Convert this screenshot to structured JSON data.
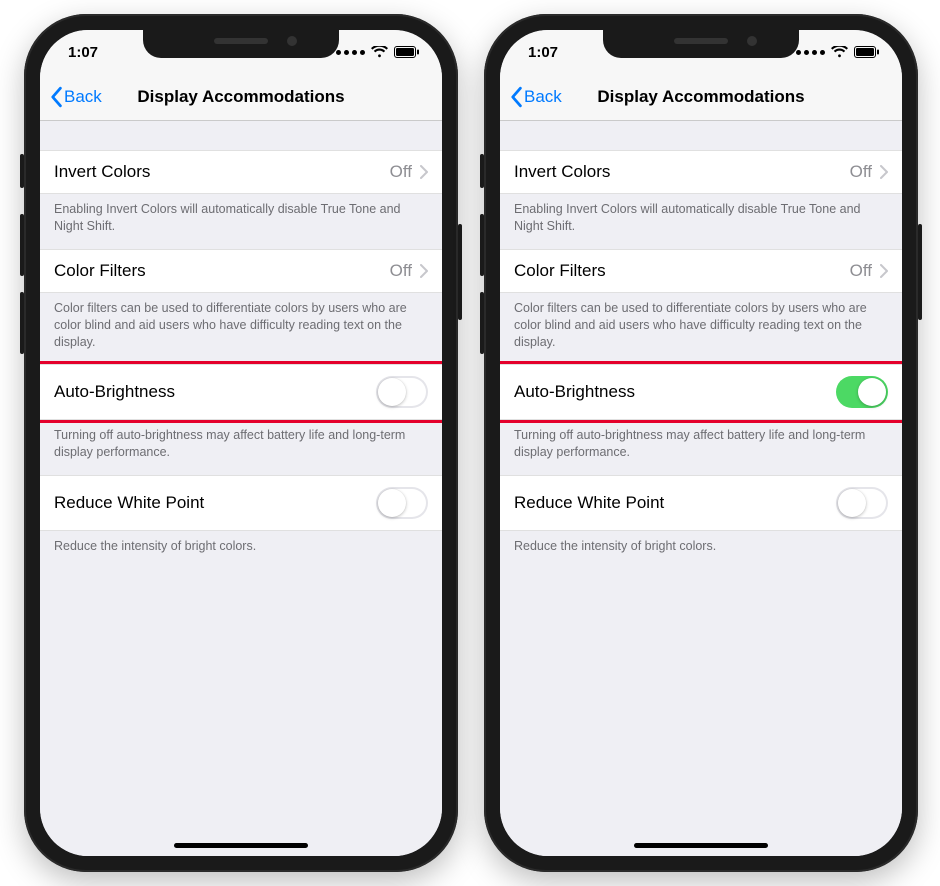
{
  "statusbar": {
    "time": "1:07"
  },
  "navbar": {
    "back": "Back",
    "title": "Display Accommodations"
  },
  "sections": {
    "invert": {
      "label": "Invert Colors",
      "value": "Off",
      "footer": "Enabling Invert Colors will automatically disable True Tone and Night Shift."
    },
    "filters": {
      "label": "Color Filters",
      "value": "Off",
      "footer": "Color filters can be used to differentiate colors by users who are color blind and aid users who have difficulty reading text on the display."
    },
    "auto_brightness": {
      "label": "Auto-Brightness",
      "footer": "Turning off auto-brightness may affect battery life and long-term display performance."
    },
    "reduce_white": {
      "label": "Reduce White Point",
      "footer": "Reduce the intensity of bright colors."
    }
  },
  "phones": {
    "left": {
      "auto_brightness_on": false,
      "reduce_white_on": false
    },
    "right": {
      "auto_brightness_on": true,
      "reduce_white_on": false
    }
  },
  "colors": {
    "accent": "#007aff",
    "switch_on": "#4cd964",
    "highlight": "#e4002b"
  }
}
